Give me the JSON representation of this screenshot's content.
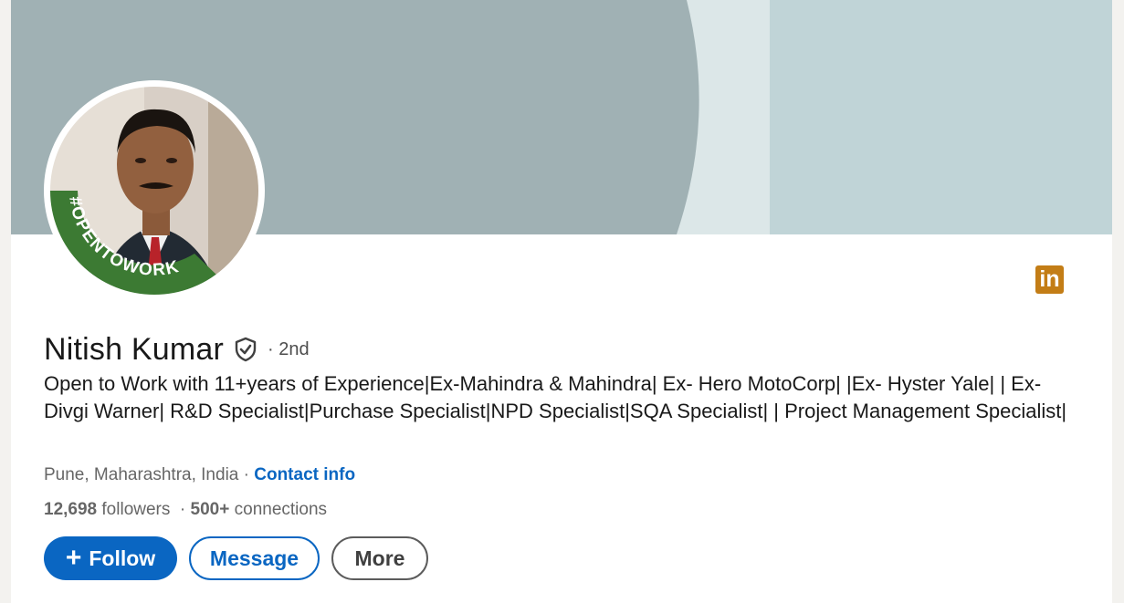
{
  "cover": {
    "colors": {
      "left": "#a0b1b4",
      "middle": "#dce7e8",
      "right": "#c0d4d7"
    }
  },
  "avatar": {
    "frame_text": "#OPENTOWORK",
    "frame_color": "#3c7a33"
  },
  "badge": {
    "label": "in",
    "color": "#c37d16"
  },
  "profile": {
    "name": "Nitish Kumar",
    "degree": "· 2nd",
    "headline": "Open to Work with 11+years of Experience|Ex-Mahindra & Mahindra| Ex- Hero MotoCorp| |Ex- Hyster Yale| | Ex- Divgi Warner| R&D Specialist|Purchase Specialist|NPD Specialist|SQA Specialist| | Project Management Specialist|",
    "location": "Pune, Maharashtra, India",
    "separator": " · ",
    "contact_info": "Contact info",
    "followers_count": "12,698",
    "followers_label": " followers",
    "connections_sep": "  · ",
    "connections_count": "500+",
    "connections_label": " connections"
  },
  "actions": {
    "follow_icon": "+",
    "follow": "Follow",
    "message": "Message",
    "more": "More"
  },
  "colors": {
    "accent": "#0a66c2",
    "text": "#191919",
    "muted": "#666666"
  }
}
